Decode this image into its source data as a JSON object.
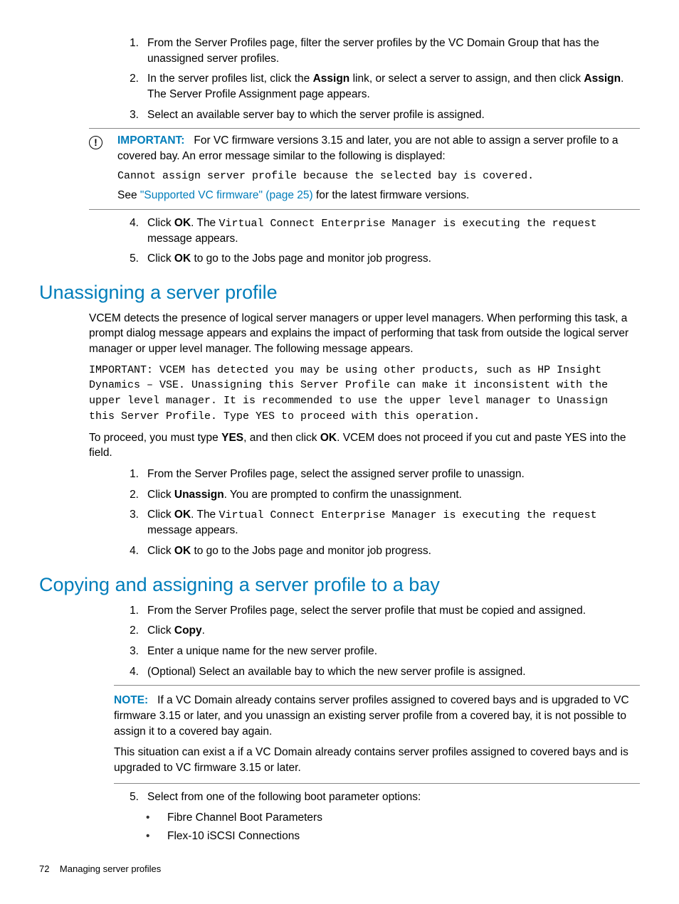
{
  "section1": {
    "steps": [
      {
        "num": "1.",
        "text": "From the Server Profiles page, filter the server profiles by the VC Domain Group that has the unassigned server profiles."
      },
      {
        "num": "2.",
        "pre": "In the server profiles list, click the ",
        "b1": "Assign",
        "mid": " link, or select a server to assign, and then click ",
        "b2": "Assign",
        "post": ". The Server Profile Assignment page appears."
      },
      {
        "num": "3.",
        "text": "Select an available server bay to which the server profile is assigned."
      }
    ],
    "callout": {
      "label": "IMPORTANT:",
      "text1": "For VC firmware versions 3.15 and later, you are not able to assign a server profile to a covered bay. An error message similar to the following is displayed:",
      "code": "Cannot assign server profile because the selected bay is covered.",
      "see": "See ",
      "link": "\"Supported VC firmware\" (page 25)",
      "after": " for the latest firmware versions."
    },
    "steps2": [
      {
        "num": "4.",
        "pre": "Click ",
        "b": "OK",
        "mid": ". The ",
        "code": "Virtual Connect Enterprise Manager is executing the request",
        "post": " message appears."
      },
      {
        "num": "5.",
        "pre": "Click ",
        "b": "OK",
        "post": " to go to the Jobs page and monitor job progress."
      }
    ]
  },
  "section2": {
    "heading": "Unassigning a server profile",
    "para1": "VCEM detects the presence of logical server managers or upper level managers. When performing this task, a prompt dialog message appears and explains the impact of performing that task from outside the logical server manager or upper level manager. The following message appears.",
    "code": "IMPORTANT: VCEM has detected you may be using other products, such as HP Insight Dynamics – VSE. Unassigning this Server Profile can make it inconsistent with the upper level manager. It is recommended to use the upper level manager to Unassign this Server Profile. Type YES to proceed with this operation.",
    "para2_pre": "To proceed, you must type ",
    "para2_b1": "YES",
    "para2_mid": ", and then click ",
    "para2_b2": "OK",
    "para2_post": ". VCEM does not proceed if you cut and paste YES into the field.",
    "steps": [
      {
        "num": "1.",
        "text": "From the Server Profiles page, select the assigned server profile to unassign."
      },
      {
        "num": "2.",
        "pre": "Click ",
        "b": "Unassign",
        "post": ". You are prompted to confirm the unassignment."
      },
      {
        "num": "3.",
        "pre": "Click ",
        "b": "OK",
        "mid": ". The ",
        "code": "Virtual Connect Enterprise Manager is executing the request",
        "post": " message appears."
      },
      {
        "num": "4.",
        "pre": "Click ",
        "b": "OK",
        "post": " to go to the Jobs page and monitor job progress."
      }
    ]
  },
  "section3": {
    "heading": "Copying and assigning a server profile to a bay",
    "steps1": [
      {
        "num": "1.",
        "text": "From the Server Profiles page, select the server profile that must be copied and assigned."
      },
      {
        "num": "2.",
        "pre": "Click ",
        "b": "Copy",
        "post": "."
      },
      {
        "num": "3.",
        "text": "Enter a unique name for the new server profile."
      },
      {
        "num": "4.",
        "text": "(Optional) Select an available bay to which the new server profile is assigned."
      }
    ],
    "note": {
      "label": "NOTE:",
      "text1": "If a VC Domain already contains server profiles assigned to covered bays and is upgraded to VC firmware 3.15 or later, and you unassign an existing server profile from a covered bay, it is not possible to assign it to a covered bay again.",
      "text2": "This situation can exist a if a VC Domain already contains server profiles assigned to covered bays and is upgraded to VC firmware 3.15 or later."
    },
    "steps2": [
      {
        "num": "5.",
        "text": "Select from one of the following boot parameter options:"
      }
    ],
    "bullets": [
      "Fibre Channel Boot Parameters",
      "Flex-10 iSCSI Connections"
    ]
  },
  "footer": {
    "page": "72",
    "title": "Managing server profiles"
  }
}
